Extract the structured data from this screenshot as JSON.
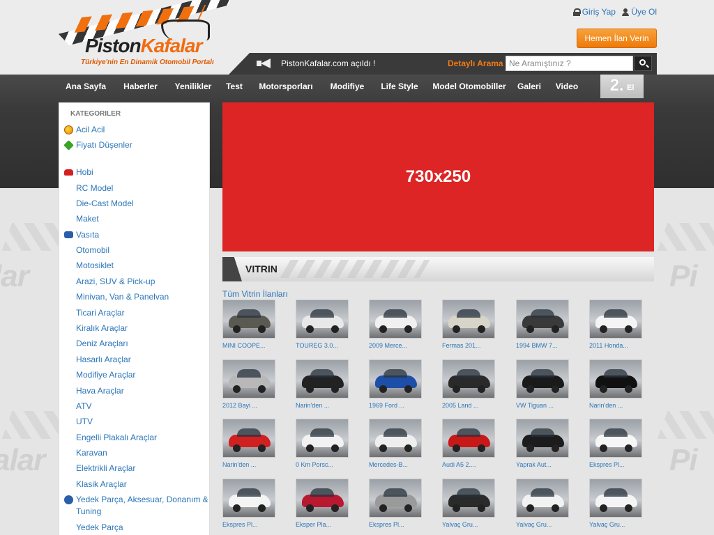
{
  "header": {
    "logo_text": "PistonKafalar",
    "logo_tagline": "Türkiye'nin En Dinamik Otomobil Portalı",
    "login": "Giriş Yap",
    "register": "Üye Ol",
    "post_ad_button": "Hemen İlan Verin",
    "announcement": "PistonKafalar.com açıldı !",
    "advanced_search": "Detaylı Arama",
    "search_placeholder": "Ne Aramıştınız ?"
  },
  "nav": {
    "items": [
      "Ana Sayfa",
      "Haberler",
      "Yenilikler",
      "Test",
      "Motorsporları",
      "Modifiye",
      "Life Style",
      "Model Otomobiller",
      "Galeri",
      "Video"
    ],
    "second_hand_big": "2.",
    "second_hand_small": "El"
  },
  "sidebar": {
    "title": "KATEGORILER",
    "items": [
      {
        "label": "Acil Acil",
        "icon": "warning-icon"
      },
      {
        "label": "Fiyatı Düşenler",
        "icon": "price-drop-icon"
      },
      {
        "label": "Hobi",
        "icon": "car-icon"
      },
      {
        "label": "RC Model"
      },
      {
        "label": "Die-Cast Model"
      },
      {
        "label": "Maket"
      },
      {
        "label": "Vasıta",
        "icon": "van-icon"
      },
      {
        "label": "Otomobil"
      },
      {
        "label": "Motosiklet"
      },
      {
        "label": "Arazi, SUV & Pick-up"
      },
      {
        "label": "Minivan, Van & Panelvan"
      },
      {
        "label": "Ticari Araçlar"
      },
      {
        "label": "Kiralık Araçlar"
      },
      {
        "label": "Deniz Araçları"
      },
      {
        "label": "Hasarlı Araçlar"
      },
      {
        "label": "Modifiye Araçlar"
      },
      {
        "label": "Hava Araçlar"
      },
      {
        "label": "ATV"
      },
      {
        "label": "UTV"
      },
      {
        "label": "Engelli Plakalı Araçlar"
      },
      {
        "label": "Karavan"
      },
      {
        "label": "Elektrikli Araçlar"
      },
      {
        "label": "Klasik Araçlar"
      },
      {
        "label": "Yedek Parça, Aksesuar, Donanım &",
        "icon": "parts-icon"
      },
      {
        "label": "Tuning"
      },
      {
        "label": "Yedek Parça"
      }
    ]
  },
  "banner": {
    "text": "730x250"
  },
  "vitrin": {
    "title": "VITRIN",
    "all_link": "Tüm Vitrin İlanları",
    "items": [
      {
        "caption": "MINI COOPE...",
        "color": "#5a5a52"
      },
      {
        "caption": "TOUREG 3.0...",
        "color": "#e8e8e8"
      },
      {
        "caption": "2009 Merce...",
        "color": "#f0f0f0"
      },
      {
        "caption": "Fermas 201...",
        "color": "#d8d4c8"
      },
      {
        "caption": "1994 BMW 7...",
        "color": "#3a3a3a"
      },
      {
        "caption": "2011 Honda...",
        "color": "#f4f4f4"
      },
      {
        "caption": "2012 Bayi ...",
        "color": "#b8b8b8"
      },
      {
        "caption": "Narin'den ...",
        "color": "#222222"
      },
      {
        "caption": "1969 Ford ...",
        "color": "#1e4fa8"
      },
      {
        "caption": "2005 Land ...",
        "color": "#2a2a2a"
      },
      {
        "caption": "VW Tiguan ...",
        "color": "#1a1a1a"
      },
      {
        "caption": "Narin'den ...",
        "color": "#111111"
      },
      {
        "caption": "Narin'den ...",
        "color": "#d02020"
      },
      {
        "caption": "0 Km Porsc...",
        "color": "#f2f2f2"
      },
      {
        "caption": "Mercedes-B...",
        "color": "#eeeeee"
      },
      {
        "caption": "Audi A5 2....",
        "color": "#c81818"
      },
      {
        "caption": "Yaprak Aut...",
        "color": "#1c1c1c"
      },
      {
        "caption": "Ekspres Pl...",
        "color": "#f6f6f6"
      },
      {
        "caption": "Ekspres Pl...",
        "color": "#f4f4f4"
      },
      {
        "caption": "Eksper Pla...",
        "color": "#b81830"
      },
      {
        "caption": "Ekspres Pl...",
        "color": "#9a9a9a"
      },
      {
        "caption": "Yalvaç Gru...",
        "color": "#2a2a2a"
      },
      {
        "caption": "Yalvaç Gru...",
        "color": "#f2f2f2"
      },
      {
        "caption": "Yalvaç Gru...",
        "color": "#f4f4f4"
      }
    ]
  },
  "colors": {
    "accent": "#f27a14",
    "link": "#2a75b8",
    "banner": "#dd2525"
  }
}
